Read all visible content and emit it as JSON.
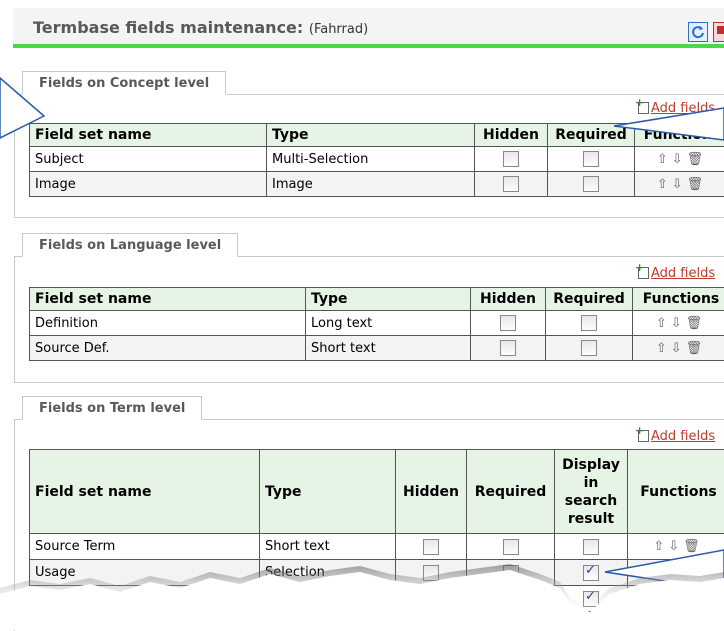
{
  "header": {
    "title": "Termbase fields maintenance:",
    "subtitle": "(Fahrrad)"
  },
  "sections": [
    {
      "tab": "Fields on Concept level",
      "add": "Add fields",
      "columns": [
        "Field set name",
        "Type",
        "Hidden",
        "Required",
        "Functions"
      ],
      "rows": [
        {
          "name": "Subject",
          "type": "Multi-Selection"
        },
        {
          "name": "Image",
          "type": "Image"
        }
      ]
    },
    {
      "tab": "Fields on Language level",
      "add": "Add fields",
      "columns": [
        "Field set name",
        "Type",
        "Hidden",
        "Required",
        "Functions"
      ],
      "rows": [
        {
          "name": "Definition",
          "type": "Long text"
        },
        {
          "name": "Source Def.",
          "type": "Short text"
        }
      ]
    },
    {
      "tab": "Fields on Term level",
      "add": "Add fields",
      "columns": [
        "Field set name",
        "Type",
        "Hidden",
        "Required",
        "Display in search result",
        "Functions"
      ],
      "rows": [
        {
          "name": "Source Term",
          "type": "Short text",
          "display": false
        },
        {
          "name": "Usage",
          "type": "Selection",
          "display": true
        }
      ]
    }
  ],
  "colors": {
    "accent_bar": "#48d84a",
    "table_header": "#e6f4e6",
    "add_link": "#c0392b"
  }
}
